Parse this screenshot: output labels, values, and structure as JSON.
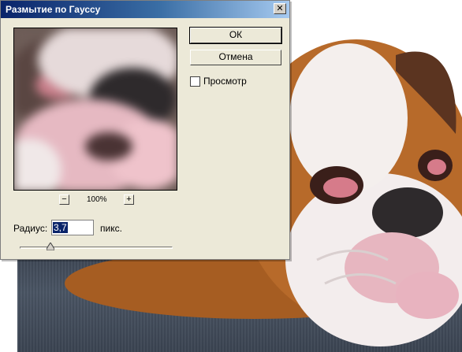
{
  "dialog": {
    "title": "Размытие по Гауссу",
    "close_glyph": "✕",
    "ok_label": "ОК",
    "cancel_label": "Отмена",
    "preview_checkbox_label": "Просмотр",
    "preview_checked": false,
    "zoom": {
      "minus": "−",
      "plus": "+",
      "value": "100%"
    },
    "radius": {
      "label": "Радиус:",
      "value": "3,7",
      "units": "пикс.",
      "slider_fraction": 0.2
    }
  },
  "colors": {
    "titlebar_start": "#0a246a",
    "titlebar_end": "#a6caf0",
    "dialog_bg": "#ece9d8"
  }
}
